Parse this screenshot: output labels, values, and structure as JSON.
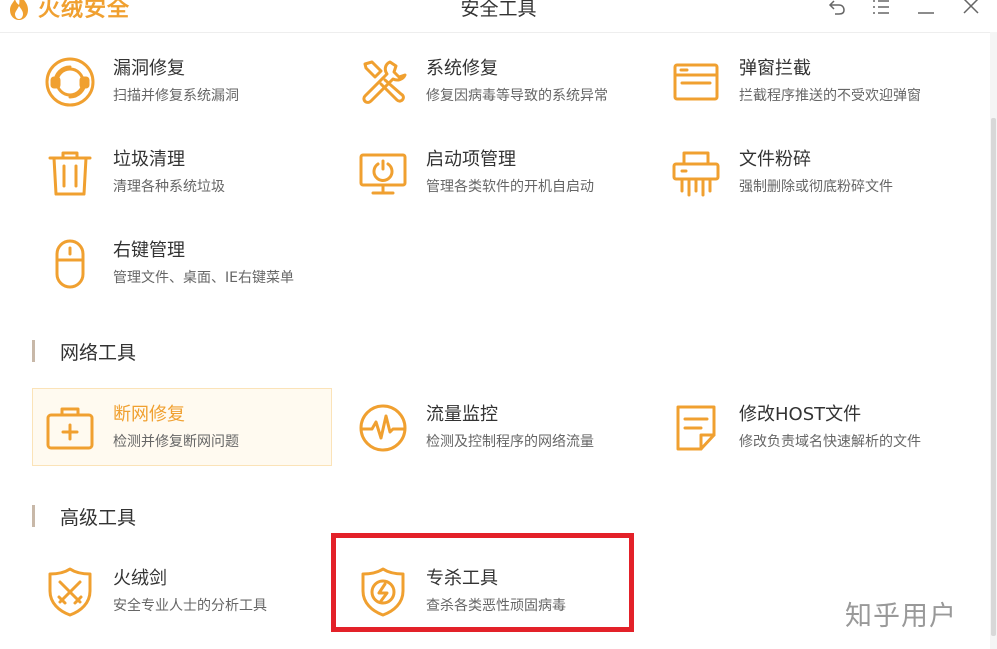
{
  "app": {
    "brand": "火绒安全",
    "title": "安全工具"
  },
  "window_controls": [
    {
      "name": "back-icon"
    },
    {
      "name": "menu-icon"
    },
    {
      "name": "minimize-icon"
    },
    {
      "name": "close-icon"
    }
  ],
  "sections": {
    "system": {
      "tools": [
        {
          "name": "漏洞修复",
          "desc": "扫描并修复系统漏洞",
          "icon": "vulnerability-fix-icon"
        },
        {
          "name": "系统修复",
          "desc": "修复因病毒等导致的系统异常",
          "icon": "system-repair-icon"
        },
        {
          "name": "弹窗拦截",
          "desc": "拦截程序推送的不受欢迎弹窗",
          "icon": "popup-block-icon"
        },
        {
          "name": "垃圾清理",
          "desc": "清理各种系统垃圾",
          "icon": "trash-icon"
        },
        {
          "name": "启动项管理",
          "desc": "管理各类软件的开机自启动",
          "icon": "startup-manage-icon"
        },
        {
          "name": "文件粉碎",
          "desc": "强制删除或彻底粉碎文件",
          "icon": "file-shredder-icon"
        },
        {
          "name": "右键管理",
          "desc": "管理文件、桌面、IE右键菜单",
          "icon": "mouse-icon"
        }
      ]
    },
    "network": {
      "title": "网络工具",
      "tools": [
        {
          "name": "断网修复",
          "desc": "检测并修复断网问题",
          "icon": "first-aid-kit-icon"
        },
        {
          "name": "流量监控",
          "desc": "检测及控制程序的网络流量",
          "icon": "traffic-monitor-icon"
        },
        {
          "name": "修改HOST文件",
          "desc": "修改负责域名快速解析的文件",
          "icon": "document-edit-icon"
        }
      ]
    },
    "advanced": {
      "title": "高级工具",
      "tools": [
        {
          "name": "火绒剑",
          "desc": "安全专业人士的分析工具",
          "icon": "sword-shield-icon"
        },
        {
          "name": "专杀工具",
          "desc": "查杀各类恶性顽固病毒",
          "icon": "lightning-shield-icon"
        }
      ]
    }
  },
  "watermark": "知乎用户",
  "colors": {
    "accent": "#f0a030",
    "highlight": "#e32129"
  }
}
